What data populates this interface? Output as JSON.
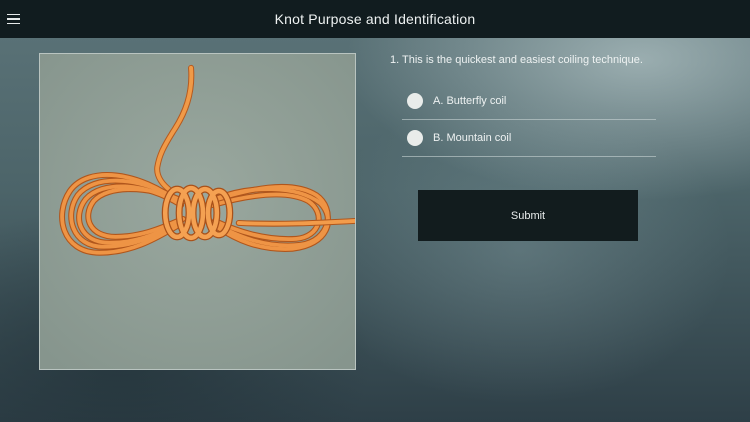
{
  "header": {
    "title": "Knot Purpose and Identification",
    "menu_icon": "hamburger-menu-icon"
  },
  "question": {
    "text": "1. This is the quickest and easiest coiling technique.",
    "image": "orange-rope-coil-photo"
  },
  "options": [
    {
      "label": "A. Butterfly coil",
      "selected": false
    },
    {
      "label": "B. Mountain coil",
      "selected": false
    }
  ],
  "submit_label": "Submit",
  "colors": {
    "topbar": "#111c1f",
    "button": "#121c1e",
    "rope": "#e8893a",
    "image_bg": "#8c9a92"
  }
}
